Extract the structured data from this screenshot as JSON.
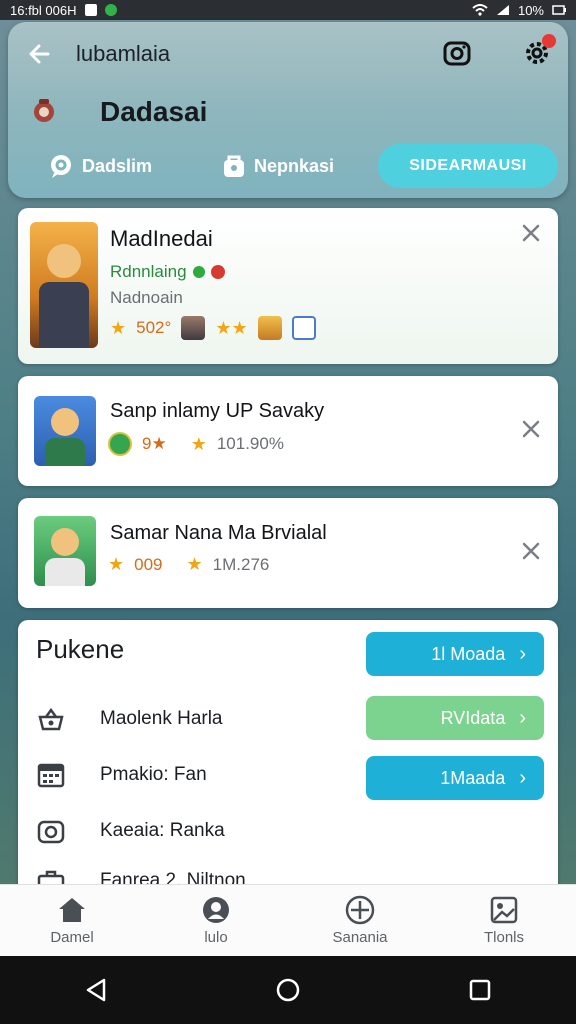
{
  "status_bar": {
    "time": "16:fbl 006H",
    "battery": "10%"
  },
  "header": {
    "title": "lubamlaia",
    "section_title": "Dadasai",
    "tabs": [
      {
        "label": "Dadslim"
      },
      {
        "label": "Nepnkasi"
      },
      {
        "label": "SIDEARMAUSI"
      }
    ]
  },
  "cards": [
    {
      "title": "MadInedai",
      "subtitle": "Rdnnlaing",
      "secondary": "Nadnoain",
      "rating": "502°"
    },
    {
      "title": "Sanp inlamy UP Savaky",
      "stat1": "9★",
      "stat2": "101.90%"
    },
    {
      "title": "Samar Nana Ma Brvialal",
      "stat1": "009",
      "stat2": "1M.276"
    }
  ],
  "panel": {
    "title": "Pukene",
    "buttons": [
      {
        "label": "1l Moada"
      },
      {
        "label": "RVIdata"
      },
      {
        "label": "1Maada"
      }
    ],
    "items": [
      {
        "label": "Maolenk Harla",
        "icon": "basket-icon"
      },
      {
        "label": "Pmakio: Fan",
        "icon": "calendar-icon"
      },
      {
        "label": "Kaeaia: Ranka",
        "icon": "camera-icon"
      },
      {
        "label": "Fanrea 2. Niltnon",
        "icon": "briefcase-icon"
      }
    ]
  },
  "bottom_nav": [
    {
      "label": "Damel",
      "icon": "home-icon"
    },
    {
      "label": "lulo",
      "icon": "profile-icon"
    },
    {
      "label": "Sanania",
      "icon": "compass-icon"
    },
    {
      "label": "Tlonls",
      "icon": "gallery-icon"
    }
  ],
  "colors": {
    "accent": "#4fd0df",
    "button_blue": "#1fb0d8",
    "button_green": "#7cd38f"
  }
}
